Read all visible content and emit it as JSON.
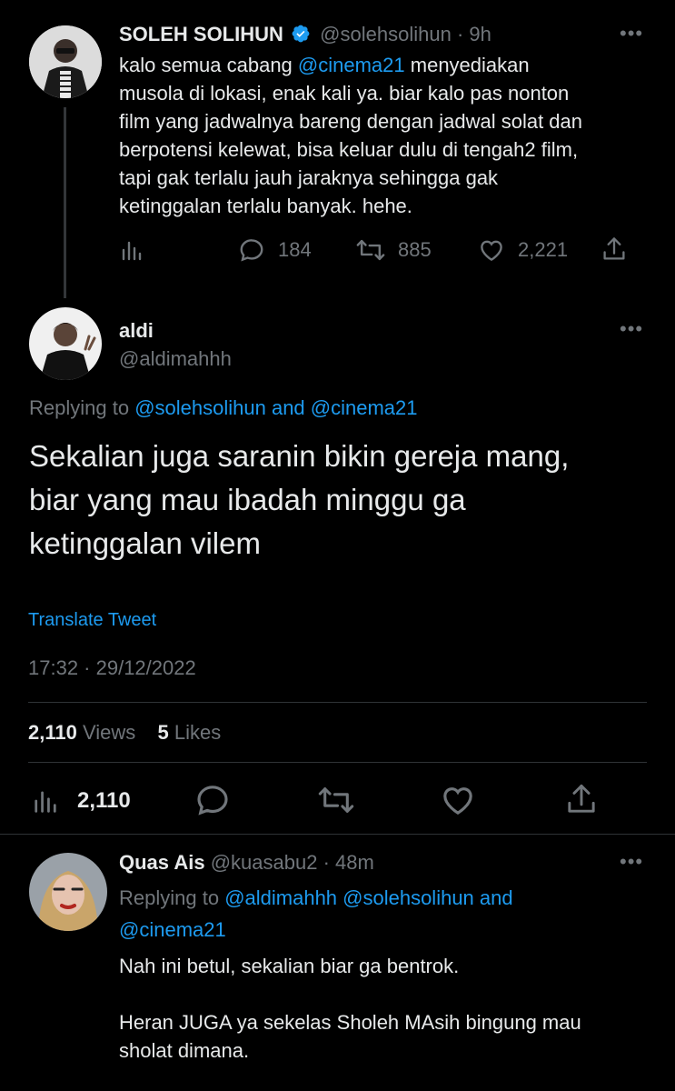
{
  "tweet1": {
    "name": "SOLEH SOLIHUN",
    "handle": "@solehsolihun",
    "time": "· 9h",
    "text_before": "kalo semua cabang ",
    "mention": "@cinema21",
    "text_after": " menyediakan\nmusola di lokasi, enak kali ya. biar kalo pas nonton\nfilm yang jadwalnya bareng dengan jadwal solat dan\nberpotensi kelewat, bisa keluar dulu di tengah2 film,\ntapi gak terlalu jauh jaraknya sehingga gak\nketinggalan terlalu banyak. hehe.",
    "replies": "184",
    "retweets": "885",
    "likes": "2,221"
  },
  "tweet2": {
    "name": "aldi",
    "handle": "@aldimahhh",
    "replying_prefix": "Replying to ",
    "replying_user1": "@solehsolihun",
    "replying_and": " and ",
    "replying_user2": "@cinema21",
    "text": "Sekalian juga saranin bikin gereja mang,\nbiar yang mau ibadah minggu ga\nketinggalan vilem",
    "translate": "Translate Tweet",
    "timestamp": "17:32 · 29/12/2022",
    "views_count": "2,110",
    "views_label": " Views",
    "likes_count": "5",
    "likes_label": " Likes",
    "action_views": "2,110"
  },
  "tweet3": {
    "name": "Quas Ais",
    "handle": "@kuasabu2",
    "time": "· 48m",
    "replying_prefix": "Replying to ",
    "replying_users_line1": "@aldimahhh @solehsolihun and",
    "replying_users_line2": "@cinema21",
    "text": "Nah ini betul, sekalian biar ga bentrok.\n\nHeran JUGA ya sekelas Sholeh MAsih bingung mau\nsholat dimana."
  },
  "icons": {
    "verified": "verified-badge-icon",
    "analytics": "analytics-icon",
    "reply": "reply-icon",
    "retweet": "retweet-icon",
    "like": "like-icon",
    "share": "share-icon",
    "more": "more-icon"
  },
  "colors": {
    "background": "#000000",
    "accent": "#1d9bf0",
    "muted": "#71767b",
    "text": "#e7e9ea",
    "divider": "#2f3336"
  }
}
